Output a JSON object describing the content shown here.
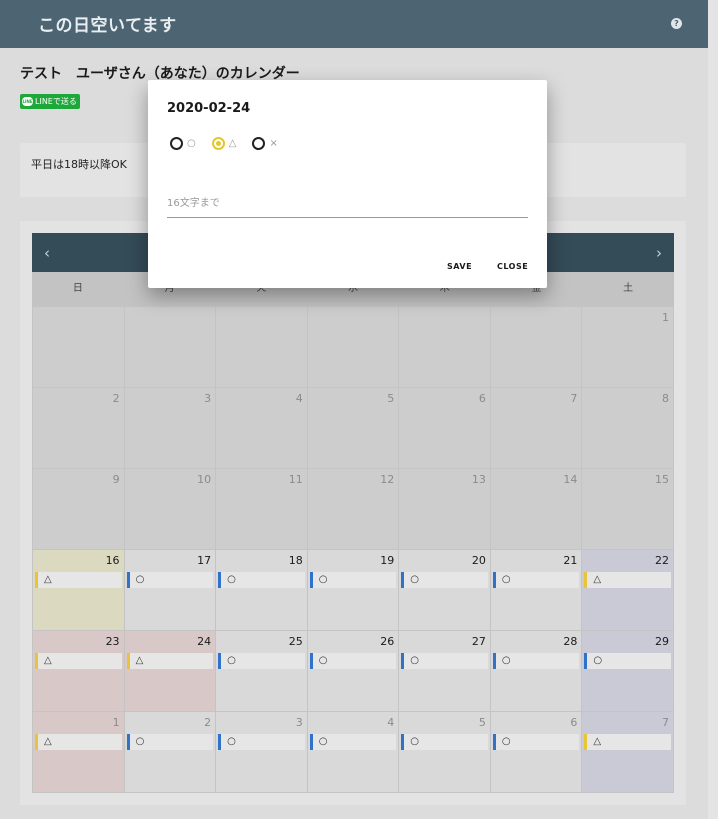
{
  "appbar": {
    "title": "この日空いてます",
    "help_icon": "?"
  },
  "page": {
    "title": "テスト　ユーザさん（あなた）のカレンダー",
    "line_share": "LINEで送る",
    "line_mark": "LINE"
  },
  "note": {
    "text": "平日は18時以降OK"
  },
  "calendar": {
    "prev": "‹",
    "next": "›",
    "weekdays": [
      "日",
      "月",
      "火",
      "水",
      "木",
      "金",
      "土"
    ],
    "cells": [
      {
        "date": "",
        "state": "past"
      },
      {
        "date": "",
        "state": "past"
      },
      {
        "date": "",
        "state": "past"
      },
      {
        "date": "",
        "state": "past"
      },
      {
        "date": "",
        "state": "past"
      },
      {
        "date": "",
        "state": "past"
      },
      {
        "date": "1",
        "state": "past"
      },
      {
        "date": "2",
        "state": "past"
      },
      {
        "date": "3",
        "state": "past"
      },
      {
        "date": "4",
        "state": "past"
      },
      {
        "date": "5",
        "state": "past"
      },
      {
        "date": "6",
        "state": "past"
      },
      {
        "date": "7",
        "state": "past"
      },
      {
        "date": "8",
        "state": "past"
      },
      {
        "date": "9",
        "state": "past"
      },
      {
        "date": "10",
        "state": "past"
      },
      {
        "date": "11",
        "state": "past"
      },
      {
        "date": "12",
        "state": "past"
      },
      {
        "date": "13",
        "state": "past"
      },
      {
        "date": "14",
        "state": "past"
      },
      {
        "date": "15",
        "state": "past"
      },
      {
        "date": "16",
        "state": "today",
        "status": "△",
        "color": "yellow"
      },
      {
        "date": "17",
        "state": "normal",
        "status": "○",
        "color": "blue"
      },
      {
        "date": "18",
        "state": "normal",
        "status": "○",
        "color": "blue"
      },
      {
        "date": "19",
        "state": "normal",
        "status": "○",
        "color": "blue"
      },
      {
        "date": "20",
        "state": "normal",
        "status": "○",
        "color": "blue"
      },
      {
        "date": "21",
        "state": "normal",
        "status": "○",
        "color": "blue"
      },
      {
        "date": "22",
        "state": "sat",
        "status": "△",
        "color": "yellow"
      },
      {
        "date": "23",
        "state": "holiday",
        "status": "△",
        "color": "yellow"
      },
      {
        "date": "24",
        "state": "holiday",
        "status": "△",
        "color": "yellow"
      },
      {
        "date": "25",
        "state": "normal",
        "status": "○",
        "color": "blue"
      },
      {
        "date": "26",
        "state": "normal",
        "status": "○",
        "color": "blue"
      },
      {
        "date": "27",
        "state": "normal",
        "status": "○",
        "color": "blue"
      },
      {
        "date": "28",
        "state": "normal",
        "status": "○",
        "color": "blue"
      },
      {
        "date": "29",
        "state": "sat",
        "status": "○",
        "color": "blue"
      },
      {
        "date": "1",
        "state": "holiday",
        "dim": true,
        "status": "△",
        "color": "yellow"
      },
      {
        "date": "2",
        "state": "normal",
        "dim": true,
        "status": "○",
        "color": "blue"
      },
      {
        "date": "3",
        "state": "normal",
        "dim": true,
        "status": "○",
        "color": "blue"
      },
      {
        "date": "4",
        "state": "normal",
        "dim": true,
        "status": "○",
        "color": "blue"
      },
      {
        "date": "5",
        "state": "normal",
        "dim": true,
        "status": "○",
        "color": "blue"
      },
      {
        "date": "6",
        "state": "normal",
        "dim": true,
        "status": "○",
        "color": "blue"
      },
      {
        "date": "7",
        "state": "sat",
        "dim": true,
        "status": "△",
        "color": "yellow"
      }
    ]
  },
  "dialog": {
    "title": "2020-02-24",
    "options": [
      {
        "label": "○",
        "checked": false
      },
      {
        "label": "△",
        "checked": true
      },
      {
        "label": "×",
        "checked": false
      }
    ],
    "placeholder": "16文字まで",
    "save": "SAVE",
    "close": "CLOSE"
  },
  "colors": {
    "appbar": "#4d6472",
    "accent_blue": "#2e73c8",
    "accent_yellow": "#e8c538",
    "line_green": "#1fa83a"
  }
}
